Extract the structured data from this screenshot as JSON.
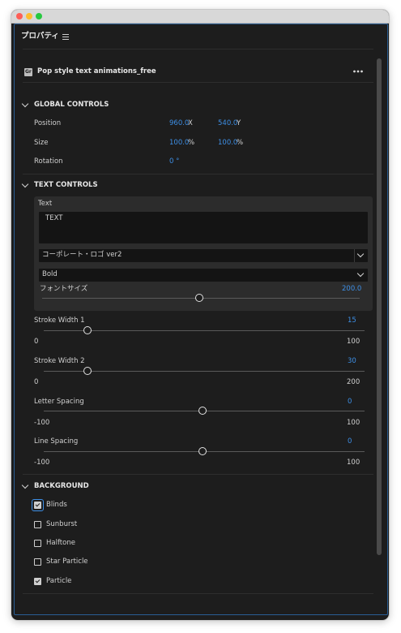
{
  "panel": {
    "title": "プロパティ",
    "menu_icon": "hamburger-icon"
  },
  "clip": {
    "icon": "graphics-icon",
    "icon_text": "Gr",
    "name": "Pop style text animations_free",
    "more_icon": "more-icon"
  },
  "global_controls": {
    "header": "GLOBAL CONTROLS",
    "position_label": "Position",
    "position_x": "960.0",
    "position_x_unit": "X",
    "position_y": "540.0",
    "position_y_unit": "Y",
    "size_label": "Size",
    "size_w": "100.0",
    "size_w_unit": "%",
    "size_h": "100.0",
    "size_h_unit": "%",
    "rotation_label": "Rotation",
    "rotation_value": "0 °"
  },
  "text_controls": {
    "header": "TEXT CONTROLS",
    "text_label": "Text",
    "text_value": "TEXT",
    "font_value": "コーポレート・ロゴ ver2",
    "style_value": "Bold",
    "font_size_label": "フォントサイズ",
    "font_size_value": "200.0",
    "font_size_level": 0.5,
    "stroke1": {
      "label": "Stroke Width 1",
      "value": "15",
      "min": "0",
      "max": "100",
      "level": 0.15
    },
    "stroke2": {
      "label": "Stroke Width 2",
      "value": "30",
      "min": "0",
      "max": "200",
      "level": 0.15
    },
    "letter_spacing": {
      "label": "Letter Spacing",
      "value": "0",
      "min": "-100",
      "max": "100",
      "level": 0.5
    },
    "line_spacing": {
      "label": "Line Spacing",
      "value": "0",
      "min": "-100",
      "max": "100",
      "level": 0.5
    }
  },
  "background": {
    "header": "BACKGROUND",
    "items": [
      {
        "label": "Blinds",
        "checked": true
      },
      {
        "label": "Sunburst",
        "checked": false
      },
      {
        "label": "Halftone",
        "checked": false
      },
      {
        "label": "Star Particle",
        "checked": false
      },
      {
        "label": "Particle",
        "checked": true
      }
    ]
  },
  "colors": {
    "accent": "#3d8fe6",
    "panel_bg": "#1d1d1d",
    "focus_border": "#2a5e95"
  }
}
